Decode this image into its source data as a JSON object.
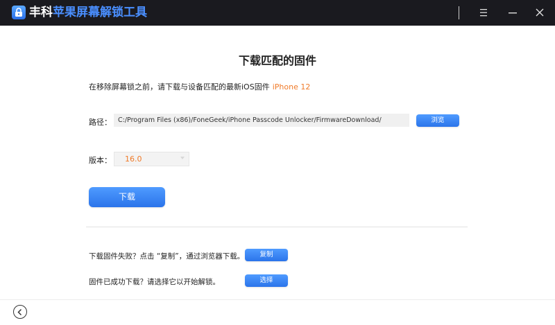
{
  "app": {
    "title_brand": "丰科",
    "title_product": "苹果屏幕解锁工具"
  },
  "page": {
    "title": "下载匹配的固件",
    "instruction": "在移除屏幕锁之前，请下载与设备匹配的最新iOS固件",
    "device": "iPhone 12"
  },
  "path": {
    "label": "路径：",
    "value": "C:/Program Files (x86)/FoneGeek/iPhone Passcode Unlocker/FirmwareDownload/",
    "browse_label": "浏览"
  },
  "version": {
    "label": "版本：",
    "selected": "16.0"
  },
  "download": {
    "label": "下载"
  },
  "help": {
    "fail_text": "下载固件失败？点击 “复制”，通过浏览器下载。",
    "copy_label": "复制",
    "done_text": "固件已成功下载？请选择它以开始解锁。",
    "select_label": "选择"
  },
  "icons": {
    "app": "lock-icon",
    "menu": "menu-icon",
    "minimize": "minimize-icon",
    "close": "close-icon",
    "back": "chevron-left-icon"
  },
  "colors": {
    "titlebar": "#1a1a1f",
    "accent_blue": "#2f7cf0",
    "highlight_orange": "#f07a28"
  }
}
